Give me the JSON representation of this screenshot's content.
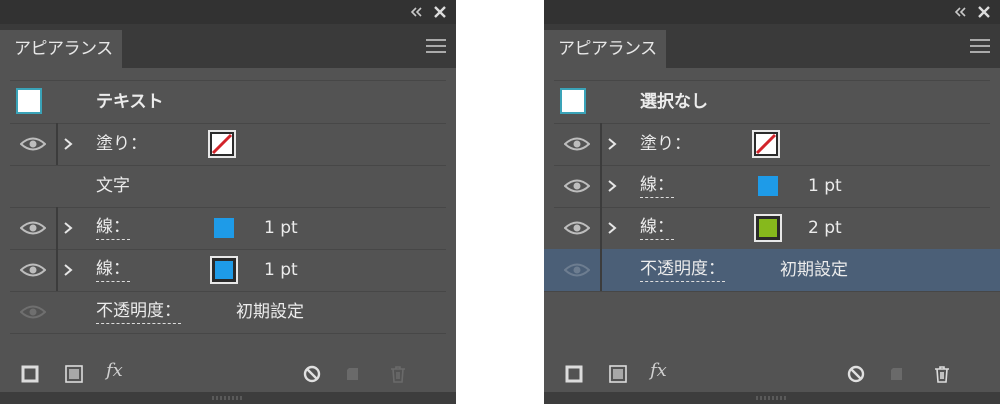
{
  "colors": {
    "panel_bg": "#535353",
    "title_bar": "#323232",
    "selected_row": "#4b5f77",
    "stroke_blue": "#1e9be8",
    "stroke_green": "#86b91c",
    "none_slash": "#d2232a"
  },
  "left_panel": {
    "tab_label": "アピアランス",
    "header_title": "テキスト",
    "rows": [
      {
        "label": "塗り：",
        "swatch": "none-swatch-icon"
      },
      {
        "label": "文字"
      },
      {
        "label": "線：",
        "value": "1 pt"
      },
      {
        "label": "線：",
        "value": "1 pt"
      },
      {
        "label": "不透明度：",
        "value": "初期設定"
      }
    ],
    "footer_fx": "fx"
  },
  "right_panel": {
    "tab_label": "アピアランス",
    "header_title": "選択なし",
    "rows": [
      {
        "label": "塗り：",
        "swatch": "none-swatch-icon"
      },
      {
        "label": "線：",
        "value": "1 pt"
      },
      {
        "label": "線：",
        "value": "2 pt"
      },
      {
        "label": "不透明度：",
        "value": "初期設定"
      }
    ],
    "footer_fx": "fx"
  }
}
